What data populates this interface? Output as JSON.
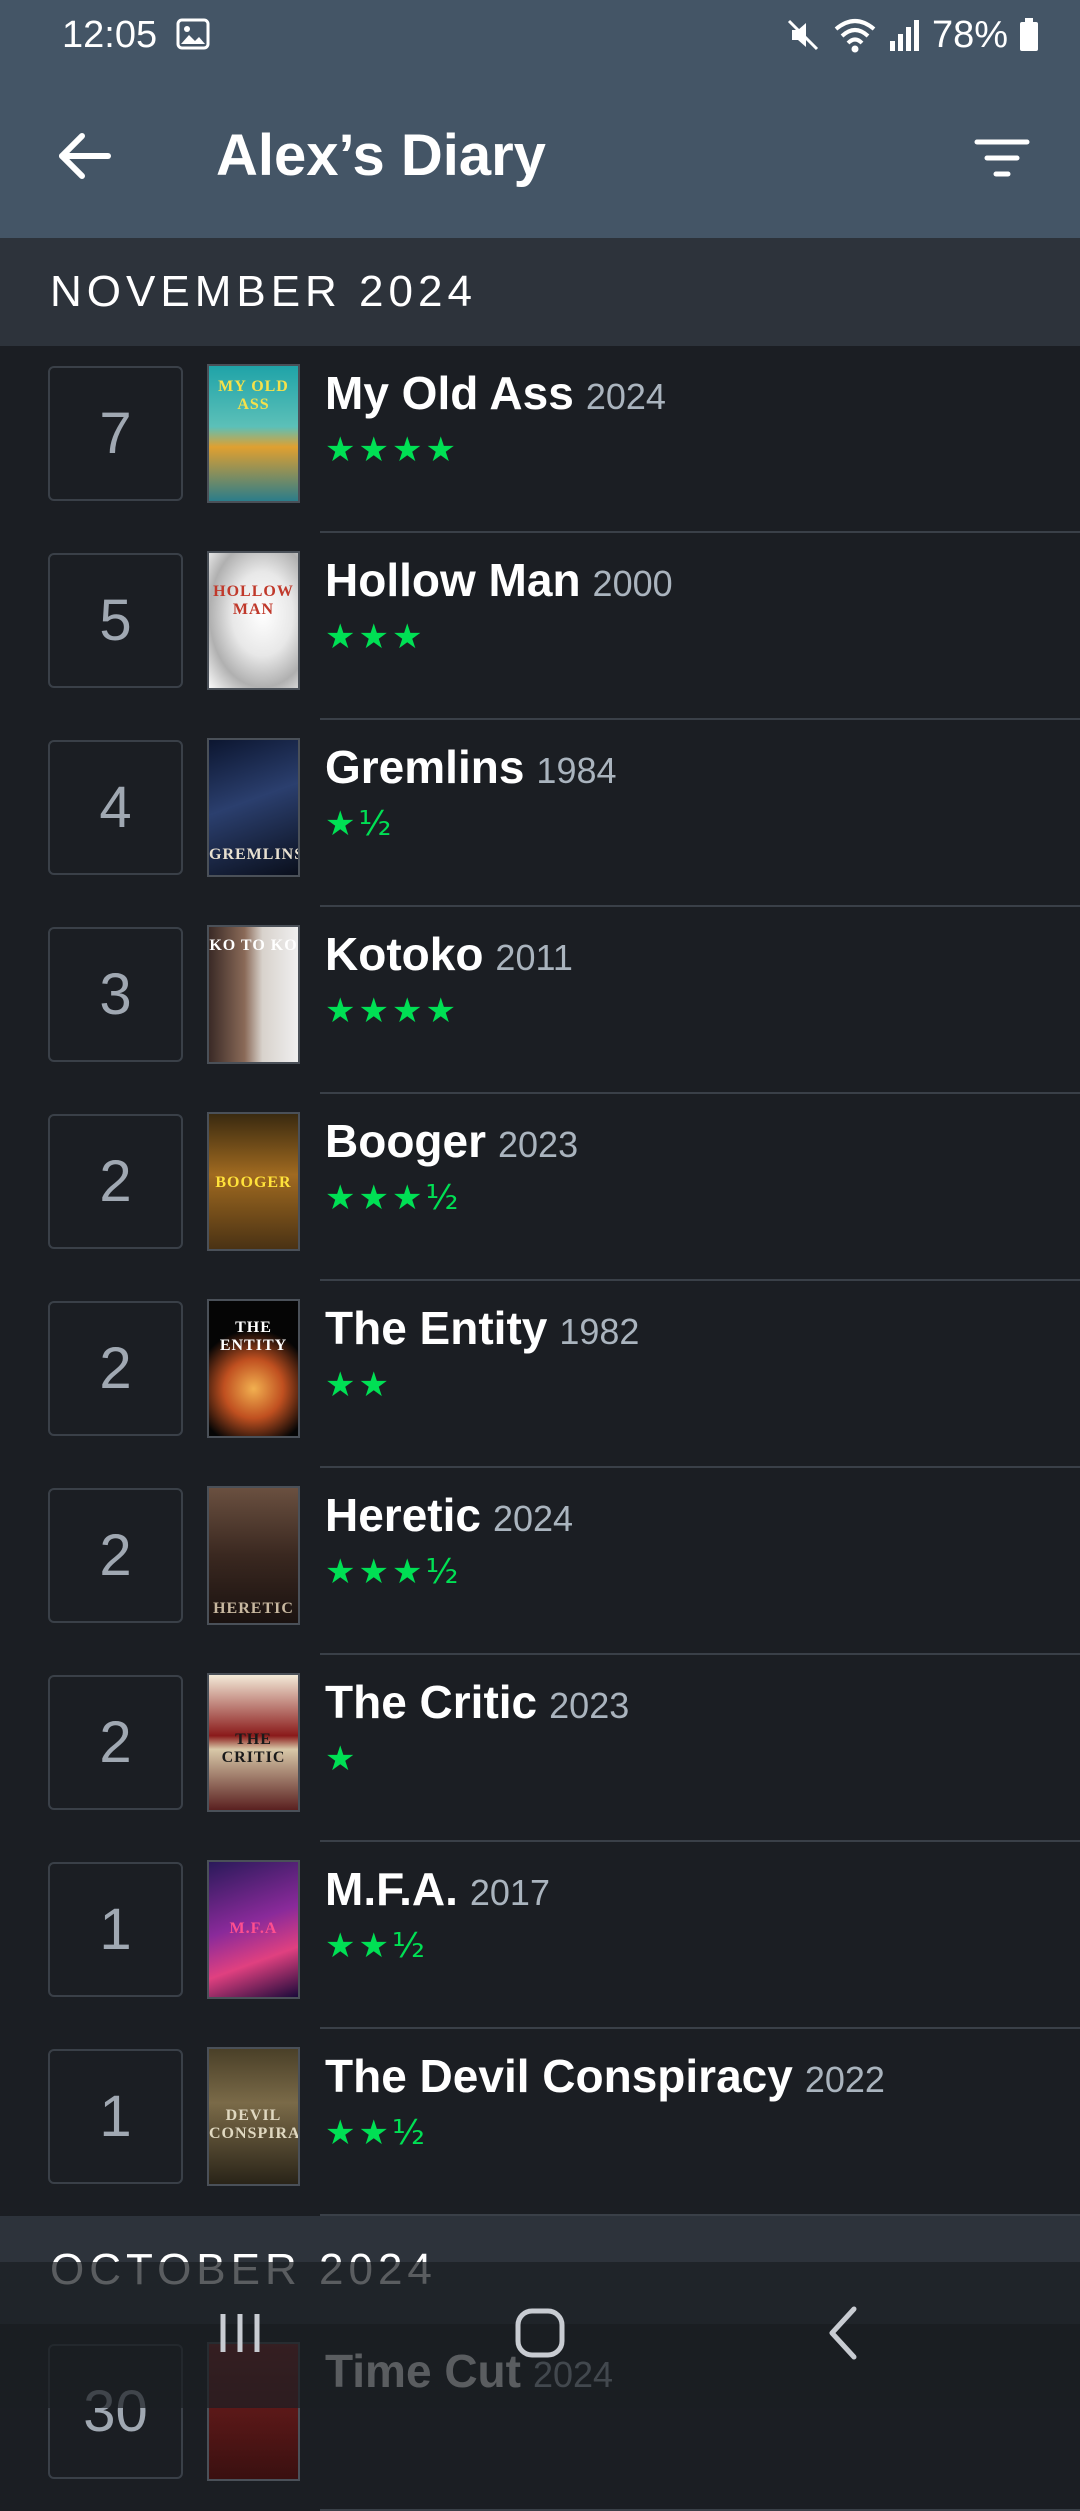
{
  "status": {
    "time": "12:05",
    "battery": "78%",
    "icons": [
      "gallery-icon",
      "mute-icon",
      "wifi-icon",
      "signal-icon",
      "battery-icon"
    ]
  },
  "header": {
    "title": "Alex’s Diary",
    "back_icon": "arrow-left-icon",
    "filter_icon": "filter-icon"
  },
  "sections": [
    {
      "month": "NOVEMBER 2024",
      "entries": [
        {
          "day": "7",
          "title": "My Old Ass",
          "year": "2024",
          "stars": "★★★★",
          "rating": 4,
          "poster_text": "MY OLD ASS"
        },
        {
          "day": "5",
          "title": "Hollow Man",
          "year": "2000",
          "stars": "★★★",
          "rating": 3,
          "poster_text": "HOLLOW MAN"
        },
        {
          "day": "4",
          "title": "Gremlins",
          "year": "1984",
          "stars": "★½",
          "rating": 1.5,
          "poster_text": "GREMLINS"
        },
        {
          "day": "3",
          "title": "Kotoko",
          "year": "2011",
          "stars": "★★★★",
          "rating": 4,
          "poster_text": "KO TO KO"
        },
        {
          "day": "2",
          "title": "Booger",
          "year": "2023",
          "stars": "★★★½",
          "rating": 3.5,
          "poster_text": "BOOGER"
        },
        {
          "day": "2",
          "title": "The Entity",
          "year": "1982",
          "stars": "★★",
          "rating": 2,
          "poster_text": "THE ENTITY"
        },
        {
          "day": "2",
          "title": "Heretic",
          "year": "2024",
          "stars": "★★★½",
          "rating": 3.5,
          "poster_text": "HERETIC"
        },
        {
          "day": "2",
          "title": "The Critic",
          "year": "2023",
          "stars": "★",
          "rating": 1,
          "poster_text": "THE CRITIC"
        },
        {
          "day": "1",
          "title": "M.F.A.",
          "year": "2017",
          "stars": "★★½",
          "rating": 2.5,
          "poster_text": "M.F.A"
        },
        {
          "day": "1",
          "title": "The Devil Conspiracy",
          "year": "2022",
          "stars": "★★½",
          "rating": 2.5,
          "poster_text": "DEVIL CONSPIRACY"
        }
      ]
    },
    {
      "month": "OCTOBER 2024",
      "entries": [
        {
          "day": "30",
          "title": "Time Cut",
          "year": "2024",
          "stars": "",
          "rating": null,
          "poster_text": ""
        }
      ]
    }
  ],
  "colors": {
    "header_bg": "#445566",
    "list_bg": "#1b1e23",
    "section_bg": "#2d333b",
    "star_green": "#00e054"
  },
  "navbar": {
    "recent_icon": "recent-apps-icon",
    "home_icon": "home-icon",
    "back_icon": "nav-back-icon"
  }
}
